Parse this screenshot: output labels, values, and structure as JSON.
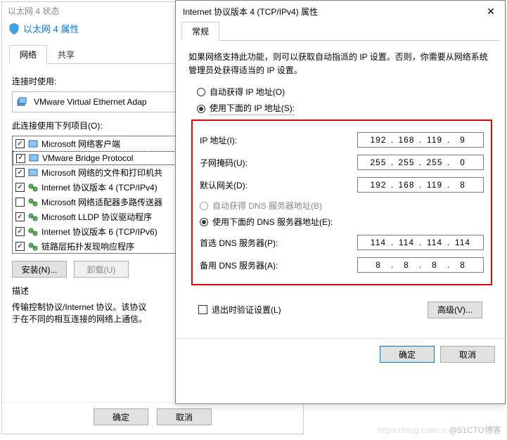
{
  "bg": {
    "status_title": "以太网 4 状态",
    "prop_title": "以太网 4 属性",
    "tabs": {
      "network": "网络",
      "share": "共享"
    },
    "connect_label": "连接时使用:",
    "adapter": "VMware Virtual Ethernet Adap",
    "items_label": "此连接使用下列项目(O):",
    "items": [
      {
        "checked": true,
        "label": "Microsoft 网络客户端",
        "icon": "client"
      },
      {
        "checked": true,
        "label": "VMware Bridge Protocol",
        "icon": "client",
        "selected": true
      },
      {
        "checked": true,
        "label": "Microsoft 网络的文件和打印机共",
        "icon": "client"
      },
      {
        "checked": true,
        "label": "Internet 协议版本 4 (TCP/IPv4)",
        "icon": "proto"
      },
      {
        "checked": false,
        "label": "Microsoft 网络适配器多路传送器",
        "icon": "proto"
      },
      {
        "checked": true,
        "label": "Microsoft LLDP 协议驱动程序",
        "icon": "proto"
      },
      {
        "checked": true,
        "label": "Internet 协议版本 6 (TCP/IPv6)",
        "icon": "proto"
      },
      {
        "checked": true,
        "label": "链路层拓扑发现响应程序",
        "icon": "proto"
      }
    ],
    "install_btn": "安装(N)...",
    "uninstall_btn": "卸载(U)",
    "desc_label": "描述",
    "desc_text1": "传输控制协议/Internet 协议。该协议",
    "desc_text2": "于在不同的相互连接的网络上通信。",
    "ok": "确定",
    "cancel": "取消"
  },
  "fg": {
    "title": "Internet 协议版本 4 (TCP/IPv4) 属性",
    "tab": "常规",
    "desc": "如果网络支持此功能，则可以获取自动指派的 IP 设置。否则，你需要从网络系统管理员处获得适当的 IP 设置。",
    "auto_ip": "自动获得 IP 地址(O)",
    "use_ip": "使用下面的 IP 地址(S):",
    "ip_label": "IP 地址(I):",
    "ip": [
      "192",
      "168",
      "119",
      "9"
    ],
    "mask_label": "子网掩码(U):",
    "mask": [
      "255",
      "255",
      "255",
      "0"
    ],
    "gw_label": "默认网关(D):",
    "gw": [
      "192",
      "168",
      "119",
      "8"
    ],
    "auto_dns": "自动获得 DNS 服务器地址(B)",
    "use_dns": "使用下面的 DNS 服务器地址(E):",
    "dns1_label": "首选 DNS 服务器(P):",
    "dns1": [
      "114",
      "114",
      "114",
      "114"
    ],
    "dns2_label": "备用 DNS 服务器(A):",
    "dns2": [
      "8",
      "8",
      "8",
      "8"
    ],
    "validate": "退出时验证设置(L)",
    "advanced": "高级(V)...",
    "ok": "确定",
    "cancel": "取消"
  },
  "watermark": "@51CTO博客",
  "watermark2": "https://blog.csdn.n"
}
